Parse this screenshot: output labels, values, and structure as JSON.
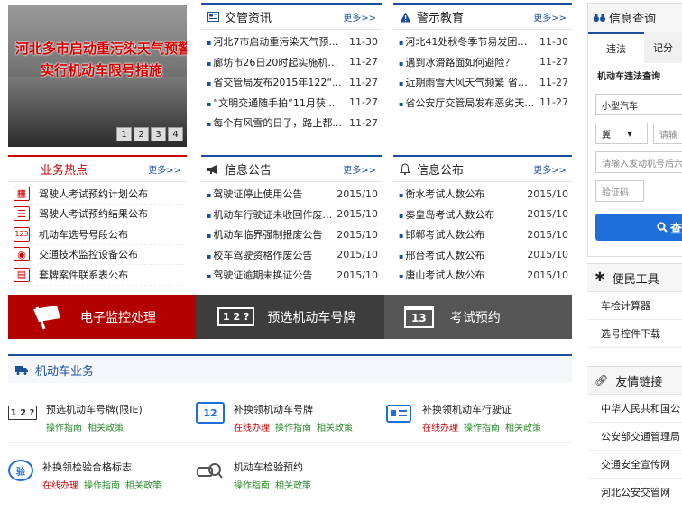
{
  "slider": {
    "caption_line1": "河北多市启动重污染天气预警",
    "caption_line2": "实行机动车限号措施",
    "pages": [
      "1",
      "2",
      "3",
      "4"
    ]
  },
  "news": {
    "title": "交管资讯",
    "more": "更多>>",
    "items": [
      {
        "text": "河北7市启动重污染天气预警...",
        "date": "11-30"
      },
      {
        "text": "廊坊市26日20时起实施机动...",
        "date": "11-27"
      },
      {
        "text": "省交管局发布2015年122“...",
        "date": "11-27"
      },
      {
        "text": "“文明交通随手拍”11月获...",
        "date": "11-27"
      },
      {
        "text": "每个有风雪的日子，路上都...",
        "date": "11-27"
      }
    ]
  },
  "warn": {
    "title": "警示教育",
    "more": "更多>>",
    "items": [
      {
        "text": "河北41处秋冬季节易发团雾...",
        "date": "11-30"
      },
      {
        "text": "遇到冰滑路面如何避险？",
        "date": "11-27"
      },
      {
        "text": "近期雨雪大风天气频繁 省交...",
        "date": "11-27"
      },
      {
        "text": "省公安厅交管局发布恶劣天...",
        "date": "11-27"
      }
    ]
  },
  "hot": {
    "title": "业务热点",
    "more": "更多>>",
    "items": [
      {
        "label": "驾驶人考试预约计划公布",
        "icon": "calendar-icon"
      },
      {
        "label": "驾驶人考试预约结果公布",
        "icon": "list-icon"
      },
      {
        "label": "机动车选号号段公布",
        "icon": "number-icon"
      },
      {
        "label": "交通技术监控设备公布",
        "icon": "camera-icon"
      },
      {
        "label": "套牌案件联系表公布",
        "icon": "table-icon"
      }
    ]
  },
  "notice": {
    "title": "信息公告",
    "more": "更多>>",
    "items": [
      {
        "text": "驾驶证停止使用公告",
        "date": "2015/10"
      },
      {
        "text": "机动车行驶证未收回作废公告",
        "date": "2015/10"
      },
      {
        "text": "机动车临界强制报废公告",
        "date": "2015/10"
      },
      {
        "text": "校车驾驶资格作废公告",
        "date": "2015/10"
      },
      {
        "text": "驾驶证逾期未换证公告",
        "date": "2015/10"
      }
    ]
  },
  "publish": {
    "title": "信息公布",
    "more": "更多>>",
    "items": [
      {
        "text": "衡水考试人数公布",
        "date": "2015/10"
      },
      {
        "text": "秦皇岛考试人数公布",
        "date": "2015/10"
      },
      {
        "text": "邯郸考试人数公布",
        "date": "2015/10"
      },
      {
        "text": "邢台考试人数公布",
        "date": "2015/10"
      },
      {
        "text": "唐山考试人数公布",
        "date": "2015/10"
      }
    ]
  },
  "banners": [
    {
      "label": "电子监控处理",
      "bg": "#b30000"
    },
    {
      "label": "预选机动车号牌",
      "bg": "#3d3d3d"
    },
    {
      "label": "考试预约",
      "bg": "#555555"
    }
  ],
  "banner_icon_text": {
    "plate": "1 2 ?",
    "calendar": "13"
  },
  "vehicle": {
    "title": "机动车业务",
    "services": [
      {
        "name": "预选机动车号牌(限IE)",
        "links": [
          "操作指南",
          "相关政策"
        ],
        "online": false
      },
      {
        "name": "补换领机动车号牌",
        "links": [
          "在线办理",
          "操作指南",
          "相关政策"
        ],
        "online": true
      },
      {
        "name": "补换领机动车行驶证",
        "links": [
          "在线办理",
          "操作指南",
          "相关政策"
        ],
        "online": true
      },
      {
        "name": "补换领检验合格标志",
        "links": [
          "在线办理",
          "操作指南",
          "相关政策"
        ],
        "online": true
      },
      {
        "name": "机动车检验预约",
        "links": [
          "操作指南",
          "相关政策"
        ],
        "online": false
      }
    ],
    "icon_text": {
      "plate": "1 2 ?",
      "cert": "12",
      "check": "验"
    }
  },
  "query": {
    "title": "信息查询",
    "tabs": [
      "违法",
      "记分"
    ],
    "subtitle": "机动车违法查询",
    "vehicle_type": "小型汽车",
    "province": "冀",
    "plate_placeholder": "请输",
    "engine_placeholder": "请输入发动机号后六",
    "captcha_placeholder": "验证码",
    "search_label": "查"
  },
  "tools": {
    "title": "便民工具",
    "items": [
      "车检计算器",
      "选号控件下载"
    ]
  },
  "links": {
    "title": "友情链接",
    "items": [
      "中华人民共和国公",
      "公安部交通管理局",
      "交通安全宣传网",
      "河北公安交管网"
    ]
  },
  "colors": {
    "brand_blue": "#1b4f9c",
    "hot_red": "#c00000",
    "search_blue": "#1e6fd9"
  }
}
